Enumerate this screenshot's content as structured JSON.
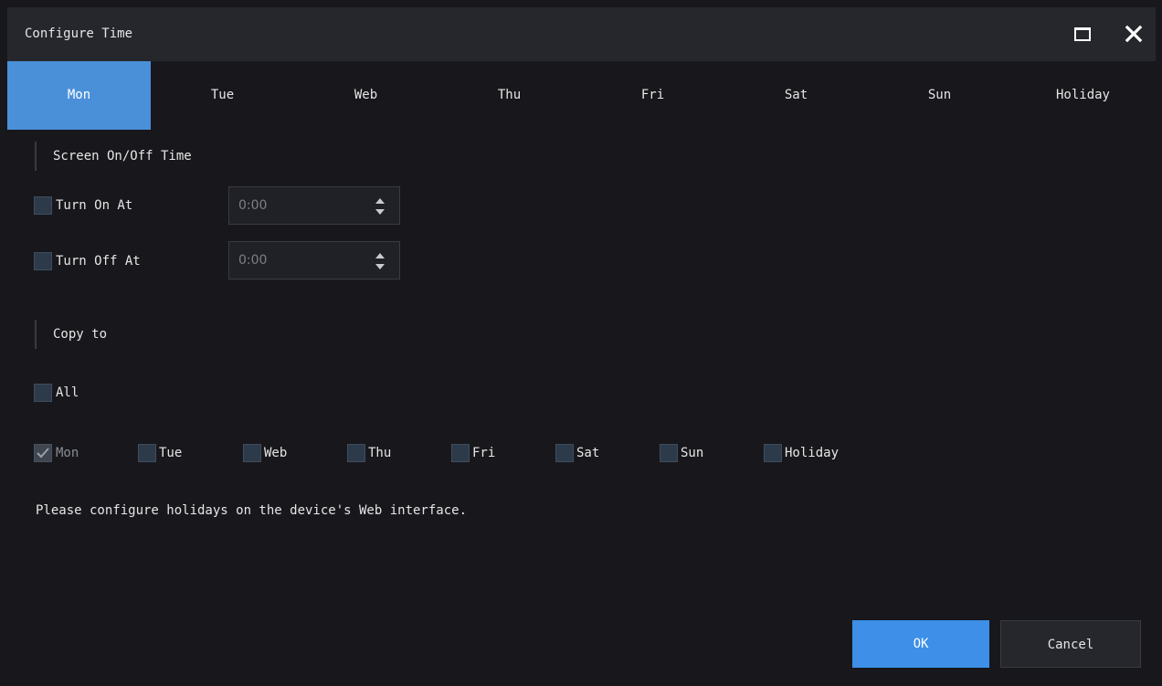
{
  "dialog": {
    "title": "Configure Time",
    "maximize_icon": "maximize-icon",
    "close_icon": "close-icon"
  },
  "tabs": [
    {
      "label": "Mon",
      "active": true
    },
    {
      "label": "Tue",
      "active": false
    },
    {
      "label": "Web",
      "active": false
    },
    {
      "label": "Thu",
      "active": false
    },
    {
      "label": "Fri",
      "active": false
    },
    {
      "label": "Sat",
      "active": false
    },
    {
      "label": "Sun",
      "active": false
    },
    {
      "label": "Holiday",
      "active": false
    }
  ],
  "screen_section": {
    "heading": "Screen On/Off Time",
    "turn_on": {
      "label": "Turn On At",
      "checked": false,
      "value": "0:00"
    },
    "turn_off": {
      "label": "Turn Off At",
      "checked": false,
      "value": "0:00"
    }
  },
  "copy_section": {
    "heading": "Copy to",
    "all": {
      "label": "All",
      "checked": false
    },
    "days": [
      {
        "label": "Mon",
        "checked": true,
        "disabled": true
      },
      {
        "label": "Tue",
        "checked": false,
        "disabled": false
      },
      {
        "label": "Web",
        "checked": false,
        "disabled": false
      },
      {
        "label": "Thu",
        "checked": false,
        "disabled": false
      },
      {
        "label": "Fri",
        "checked": false,
        "disabled": false
      },
      {
        "label": "Sat",
        "checked": false,
        "disabled": false
      },
      {
        "label": "Sun",
        "checked": false,
        "disabled": false
      },
      {
        "label": "Holiday",
        "checked": false,
        "disabled": false
      }
    ]
  },
  "note": "Please configure holidays on the device's Web interface.",
  "buttons": {
    "ok": "OK",
    "cancel": "Cancel"
  },
  "colors": {
    "background": "#18181c",
    "titlebar": "#26272c",
    "accent": "#3d8fe8",
    "active_tab": "#4a90d9"
  }
}
